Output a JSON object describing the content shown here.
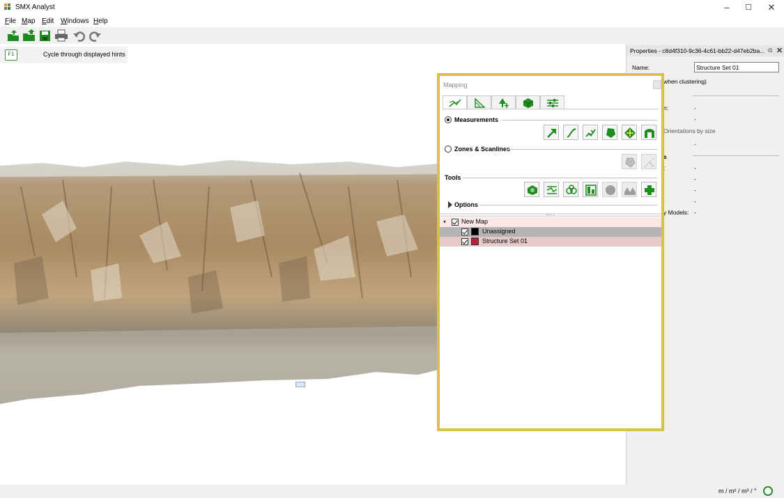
{
  "window": {
    "title": "SMX Analyst",
    "controls": [
      "–",
      "☐",
      "✕"
    ]
  },
  "menu": {
    "items": [
      {
        "first": "F",
        "rest": "ile"
      },
      {
        "first": "M",
        "rest": "ap"
      },
      {
        "first": "E",
        "rest": "dit"
      },
      {
        "first": "W",
        "rest": "indows"
      },
      {
        "first": "H",
        "rest": "elp"
      }
    ]
  },
  "toolbar": {
    "icons": [
      "open-icon",
      "open-folder-icon",
      "save-icon",
      "print-icon",
      "undo-icon",
      "redo-icon"
    ]
  },
  "hint": {
    "key": "F1",
    "text": "Cycle through displayed hints"
  },
  "viewport": {
    "side_tools": [
      "camera-icon",
      "map-view-icon"
    ]
  },
  "properties": {
    "title": "Properties - c8d4f310-9c36-4c61-bb22-d47eb2ba...",
    "name_label": "Name:",
    "name_value": "Structure Set 01",
    "row_when_clustering": "when clustering)",
    "row_dash": "-",
    "row_n_suffix": "n:",
    "row_orientations": "Orientations by size",
    "row_s": "s",
    "row_colon": ":",
    "row_models": "y Models:"
  },
  "mapping": {
    "title": "Mapping",
    "tabs": [
      "measurements-tab",
      "angles-tab",
      "vegetation-tab",
      "solids-tab",
      "settings-tab"
    ],
    "measurements_label": "Measurements",
    "zones_label": "Zones & Scanlines",
    "tools_label": "Tools",
    "options_label": "Options",
    "tree": {
      "root": "New Map",
      "children": [
        {
          "label": "Unassigned",
          "color": "#000000"
        },
        {
          "label": "Structure Set 01",
          "color": "#b0233a"
        }
      ]
    }
  },
  "status": {
    "units": "m / m² / m³ / °"
  },
  "colors": {
    "accent_green": "#1f8c1f",
    "highlight_border": "#d4c24a"
  }
}
